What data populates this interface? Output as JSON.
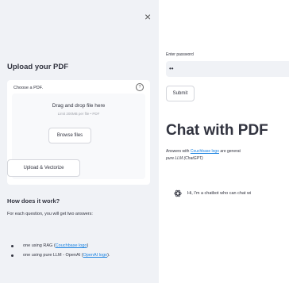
{
  "sidebar": {
    "close_label": "×",
    "title": "Upload your PDF",
    "uploader": {
      "label": "Choose a PDF.",
      "help_icon": "?",
      "drop_title": "Drag and drop file here",
      "drop_sub": "Limit 200MB per file • PDF",
      "browse_label": "Browse files"
    },
    "upload_button": "Upload & Vectorize",
    "how": {
      "title": "How does it work?",
      "description": "For each question, you will get two answers:",
      "items": [
        {
          "prefix": "one using RAG (",
          "link": "Couchbase logo",
          "suffix": ")"
        },
        {
          "prefix": "one using pure LLM - OpenAI (",
          "link": "OpenAI logo",
          "suffix": ")."
        }
      ]
    }
  },
  "main": {
    "password_label": "Enter password",
    "password_value": "••",
    "submit_label": "Submit",
    "title": "Chat with PDF",
    "answers_prefix": "Answers with ",
    "answers_link": "Couchbase logo",
    "answers_suffix": " are generat",
    "answers_line2": "pure LLM (ChatGPT)",
    "assistant_message": "Hi, I'm a chatbot who can chat wi"
  },
  "colors": {
    "sidebar_bg": "#f0f2f6",
    "link": "#1c83e1",
    "text": "#31333f"
  }
}
